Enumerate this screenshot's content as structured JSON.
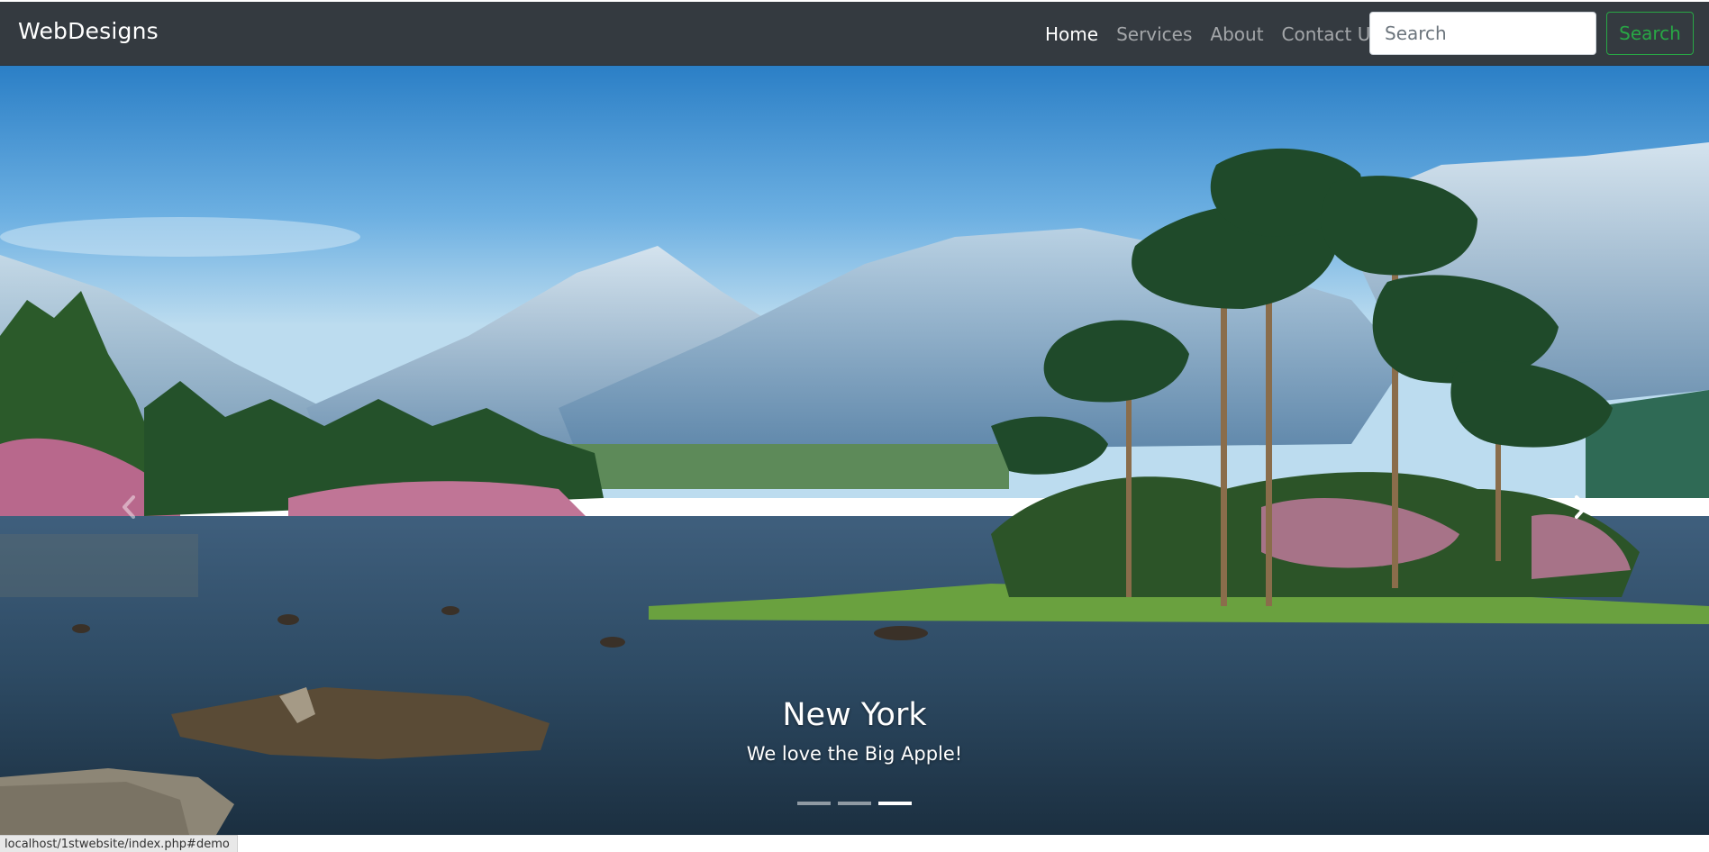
{
  "navbar": {
    "brand": "WebDesigns",
    "links": [
      {
        "label": "Home",
        "active": true
      },
      {
        "label": "Services",
        "active": false
      },
      {
        "label": "About",
        "active": false
      },
      {
        "label": "Contact Us",
        "active": false
      }
    ],
    "search": {
      "placeholder": "Search",
      "value": ""
    },
    "search_button_label": "Search"
  },
  "carousel": {
    "slide_title": "New York",
    "slide_text": "We love the Big Apple!",
    "prev_icon": "chevron-left-icon",
    "next_icon": "chevron-right-icon",
    "slide_count": 3,
    "active_slide": 3,
    "image_description_icon": "landscape-image"
  },
  "status_bar": {
    "url": "localhost/1stwebsite/index.php#demo"
  },
  "colors": {
    "navbar_bg": "#343a40",
    "success": "#28a745",
    "link_active": "#ffffff",
    "link_inactive": "rgba(255,255,255,0.55)"
  }
}
